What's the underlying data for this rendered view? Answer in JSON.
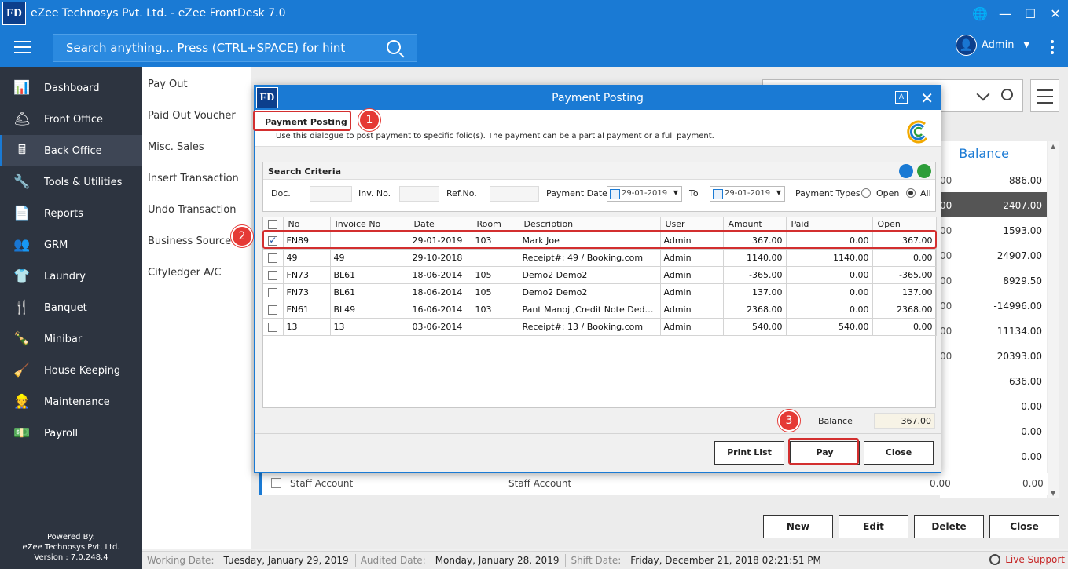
{
  "app": {
    "logo_text": "FD",
    "window_title": "eZee Technosys Pvt. Ltd. - eZee FrontDesk 7.0"
  },
  "toolbar": {
    "search_placeholder": "Search anything... Press (CTRL+SPACE) for hint",
    "user_name": "Admin"
  },
  "sidebar": {
    "items": [
      {
        "label": "Dashboard",
        "icon": "📊"
      },
      {
        "label": "Front Office",
        "icon": "🛎"
      },
      {
        "label": "Back Office",
        "icon": "🖩"
      },
      {
        "label": "Tools & Utilities",
        "icon": "🔧"
      },
      {
        "label": "Reports",
        "icon": "📄"
      },
      {
        "label": "GRM",
        "icon": "👥"
      },
      {
        "label": "Laundry",
        "icon": "👕"
      },
      {
        "label": "Banquet",
        "icon": "🍴"
      },
      {
        "label": "Minibar",
        "icon": "🍾"
      },
      {
        "label": "House Keeping",
        "icon": "🧹"
      },
      {
        "label": "Maintenance",
        "icon": "👷"
      },
      {
        "label": "Payroll",
        "icon": "💵"
      }
    ],
    "powered_line1": "Powered By:",
    "powered_line2": "eZee Technosys Pvt. Ltd.",
    "powered_line3": "Version : 7.0.248.4"
  },
  "submenu": {
    "items": [
      "Pay Out",
      "Paid Out Voucher",
      "Misc. Sales",
      "Insert Transaction",
      "Undo Transaction",
      "Business Source",
      "Cityledger A/C"
    ]
  },
  "background": {
    "balance_header": "Balance",
    "left_cells": [
      "00",
      "00",
      "00",
      "00",
      "00",
      "00",
      "00",
      "00"
    ],
    "balances": [
      "886.00",
      "2407.00",
      "1593.00",
      "24907.00",
      "8929.50",
      "-14996.00",
      "11134.00",
      "20393.00",
      "636.00",
      "0.00",
      "0.00",
      "0.00"
    ],
    "staff_row": {
      "name": "Staff Account",
      "type": "Staff Account",
      "a": "0.00",
      "b": "0.00"
    },
    "buttons": {
      "new": "New",
      "edit": "Edit",
      "delete": "Delete",
      "close": "Close"
    }
  },
  "statusbar": {
    "working_label": "Working Date:",
    "working_value": "Tuesday, January 29, 2019",
    "audited_label": "Audited Date:",
    "audited_value": "Monday, January 28, 2019",
    "shift_label": "Shift Date:",
    "shift_value": "Friday, December 21, 2018 02:21:51 PM",
    "live_support": "Live Support"
  },
  "dialog": {
    "title": "Payment Posting",
    "translate_icon": "A",
    "heading": "Payment Posting",
    "description": "Use this dialogue to post payment to specific folio(s). The payment can be a partial payment or a full payment.",
    "criteria": {
      "caption": "Search Criteria",
      "doc_label": "Doc.",
      "inv_label": "Inv. No.",
      "ref_label": "Ref.No.",
      "payment_date_label": "Payment Date",
      "from_date": "29-01-2019",
      "to_label": "To",
      "to_date": "29-01-2019",
      "payment_types_label": "Payment Types",
      "open_label": "Open",
      "all_label": "All",
      "selected_type": "All"
    },
    "columns": [
      "No",
      "Invoice No",
      "Date",
      "Room",
      "Description",
      "User",
      "Amount",
      "Paid",
      "Open"
    ],
    "rows": [
      {
        "checked": true,
        "no": "FN89",
        "invoice": "",
        "date": "29-01-2019",
        "room": "103",
        "description": "Mark Joe",
        "user": "Admin",
        "amount": "367.00",
        "paid": "0.00",
        "open": "367.00"
      },
      {
        "checked": false,
        "no": "49",
        "invoice": "49",
        "date": "29-10-2018",
        "room": "",
        "description": "Receipt#: 49  /  Booking.com",
        "user": "Admin",
        "amount": "1140.00",
        "paid": "1140.00",
        "open": "0.00"
      },
      {
        "checked": false,
        "no": "FN73",
        "invoice": "BL61",
        "date": "18-06-2014",
        "room": "105",
        "description": "Demo2 Demo2",
        "user": "Admin",
        "amount": "-365.00",
        "paid": "0.00",
        "open": "-365.00"
      },
      {
        "checked": false,
        "no": "FN73",
        "invoice": "BL61",
        "date": "18-06-2014",
        "room": "105",
        "description": "Demo2 Demo2",
        "user": "Admin",
        "amount": "137.00",
        "paid": "0.00",
        "open": "137.00"
      },
      {
        "checked": false,
        "no": "FN61",
        "invoice": "BL49",
        "date": "16-06-2014",
        "room": "103",
        "description": "Pant Manoj ,Credit Note Deduction",
        "user": "Admin",
        "amount": "2368.00",
        "paid": "0.00",
        "open": "2368.00"
      },
      {
        "checked": false,
        "no": "13",
        "invoice": "13",
        "date": "03-06-2014",
        "room": "",
        "description": "Receipt#: 13  /  Booking.com",
        "user": "Admin",
        "amount": "540.00",
        "paid": "540.00",
        "open": "0.00"
      }
    ],
    "balance_label": "Balance",
    "balance_value": "367.00",
    "buttons": {
      "print": "Print List",
      "pay": "Pay",
      "close": "Close"
    },
    "markers": [
      "1",
      "2",
      "3"
    ]
  },
  "colors": {
    "accent": "#1a7ad4",
    "sidebar": "#2d3440",
    "highlight": "#d32f2f"
  }
}
